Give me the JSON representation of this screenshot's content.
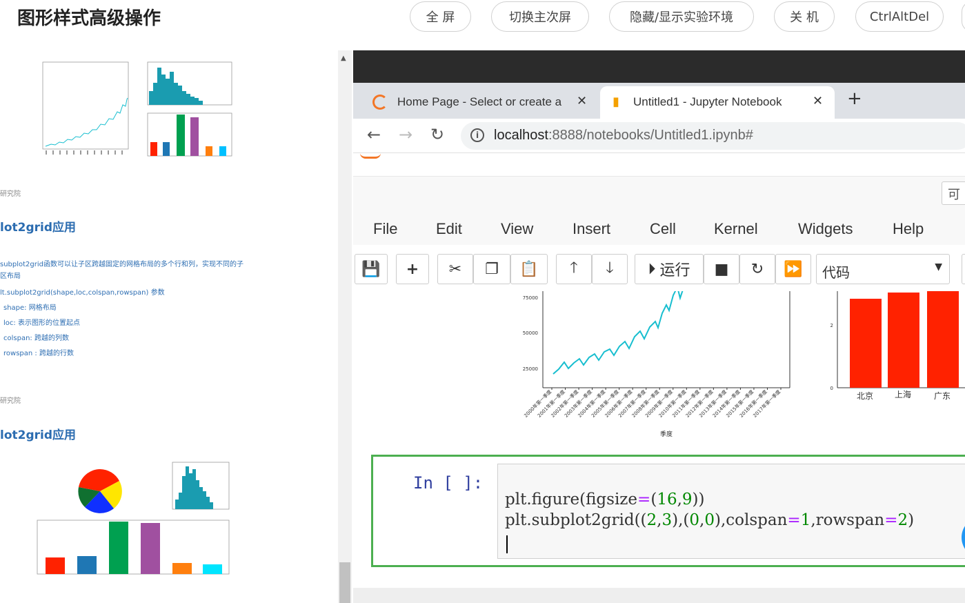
{
  "header": {
    "title": "图形样式高级操作",
    "buttons": [
      "全 屏",
      "切换主次屏",
      "隐藏/显示实验环境",
      "关 机",
      "CtrlAltDel"
    ]
  },
  "slides": {
    "note1": "研究院",
    "heading1": "lot2grid应用",
    "desc_lines": [
      "subplot2grid函数可以让子区跨越固定的网格布局的多个行和列，实现不同的子",
      "区布局",
      "lt.subplot2grid(shape,loc,colspan,rowspan) 参数",
      "shape: 网格布局",
      "loc: 表示图形的位置起点",
      "colspan: 跨越的列数",
      "rowspan : 跨越的行数"
    ],
    "note2": "研究院",
    "heading2": "lot2grid应用"
  },
  "browser": {
    "tabs": [
      {
        "label": "Home Page - Select or create a"
      },
      {
        "label": "Untitled1 - Jupyter Notebook"
      }
    ],
    "url_host": "localhost",
    "url_rest": ":8888/notebooks/Untitled1.ipynb#"
  },
  "jupyter": {
    "trusted": "可",
    "menu": [
      "File",
      "Edit",
      "View",
      "Insert",
      "Cell",
      "Kernel",
      "Widgets",
      "Help"
    ],
    "run_label": "运行",
    "cell_type": "代码",
    "prompt": "In  [  ]:",
    "code_lines": [
      "plt.figure(figsize=(16,9))",
      "plt.subplot2grid((2,3),(0,0),colspan=1,rowspan=2)"
    ],
    "circle_btn": "I"
  },
  "output_chart": {
    "y_ticks": [
      "75000",
      "50000",
      "25000"
    ],
    "x_ticks": [
      "2000年第一季度",
      "2001年第一季度",
      "2002年第一季度",
      "2003年第一季度",
      "2004年第一季度",
      "2005年第一季度",
      "2006年第一季度",
      "2007年第一季度",
      "2008年第一季度",
      "2009年第一季度",
      "2010年第一季度",
      "2011年第一季度",
      "2012年第一季度",
      "2013年第一季度",
      "2014年第一季度",
      "2015年第一季度",
      "2016年第一季度",
      "2017年第一季度"
    ],
    "xlabel": "季度",
    "bar_categories": [
      "北京",
      "上海",
      "广东"
    ],
    "bar_y_ticks": [
      "2",
      "0"
    ],
    "line_color": "#17becf",
    "bar_color": "#ff2200"
  },
  "colors": {
    "accent_blue": "#2b6cb0",
    "cell_border": "#4caf50",
    "prompt_color": "#303f9f"
  }
}
